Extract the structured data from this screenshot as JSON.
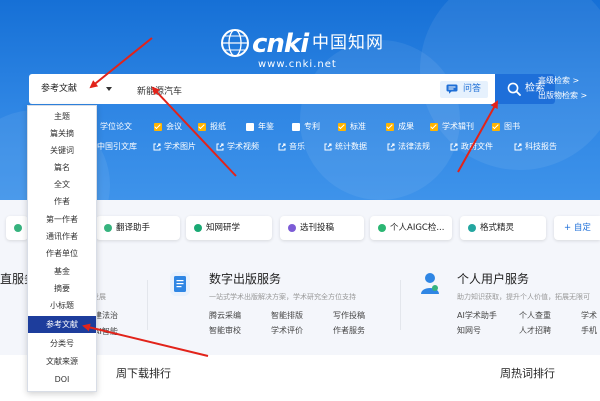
{
  "logo": {
    "brand": "cnki",
    "chinese": "中国知网",
    "url": "www.cnki.net"
  },
  "search": {
    "db_selected": "参考文献",
    "query": "新能源汽车",
    "ask_label": "问答",
    "search_label": "检索",
    "advanced": "高级检索 >",
    "publication": "出版物检索 >"
  },
  "types": [
    {
      "label": "学位论文",
      "checked": true
    },
    {
      "label": "会议",
      "checked": true
    },
    {
      "label": "报纸",
      "checked": true
    },
    {
      "label": "年鉴",
      "checked": false
    },
    {
      "label": "专利",
      "checked": false
    },
    {
      "label": "标准",
      "checked": true
    },
    {
      "label": "成果",
      "checked": true
    },
    {
      "label": "学术辑刊",
      "checked": true
    },
    {
      "label": "图书",
      "checked": true
    }
  ],
  "links": [
    "中国引文库",
    "学术图片",
    "学术视频",
    "音乐",
    "统计数据",
    "法律法规",
    "政府文件",
    "科技报告"
  ],
  "tools": [
    "翻译助手",
    "知网研学",
    "选刊投稿",
    "个人AIGC检...",
    "格式精灵",
    "+ 自定"
  ],
  "dropdown": {
    "items": [
      "主题",
      "篇关摘",
      "关键词",
      "篇名",
      "全文",
      "作者",
      "第一作者",
      "通讯作者",
      "作者单位",
      "基金",
      "摘要",
      "小标题",
      "参考文献",
      "分类号",
      "文献来源",
      "DOI"
    ],
    "active_index": 12
  },
  "services": [
    {
      "title": "直服务",
      "sub": "发展",
      "links": [
        "建法治",
        "AI智能"
      ]
    },
    {
      "title": "数字出版服务",
      "sub": "一站式学术出版解决方案，学术研究全方位支持",
      "links": [
        "腾云采编",
        "智能排版",
        "写作投稿",
        "智能审校",
        "学术评价",
        "作者服务"
      ]
    },
    {
      "title": "个人用户服务",
      "sub": "助力知识获取，提升个人价值，拓展无限可",
      "links": [
        "AI学术助手",
        "个人查重",
        "学术",
        "知网号",
        "人才招聘",
        "手机"
      ]
    }
  ],
  "bottom": {
    "download_rank": "周下载排行",
    "hotword_rank": "周热词排行"
  },
  "colors": {
    "primary": "#1e6fd9",
    "hero": "#2f86e4",
    "checkbox": "#ffb400",
    "arrow": "#e2231a",
    "active": "#1d3d9c"
  }
}
